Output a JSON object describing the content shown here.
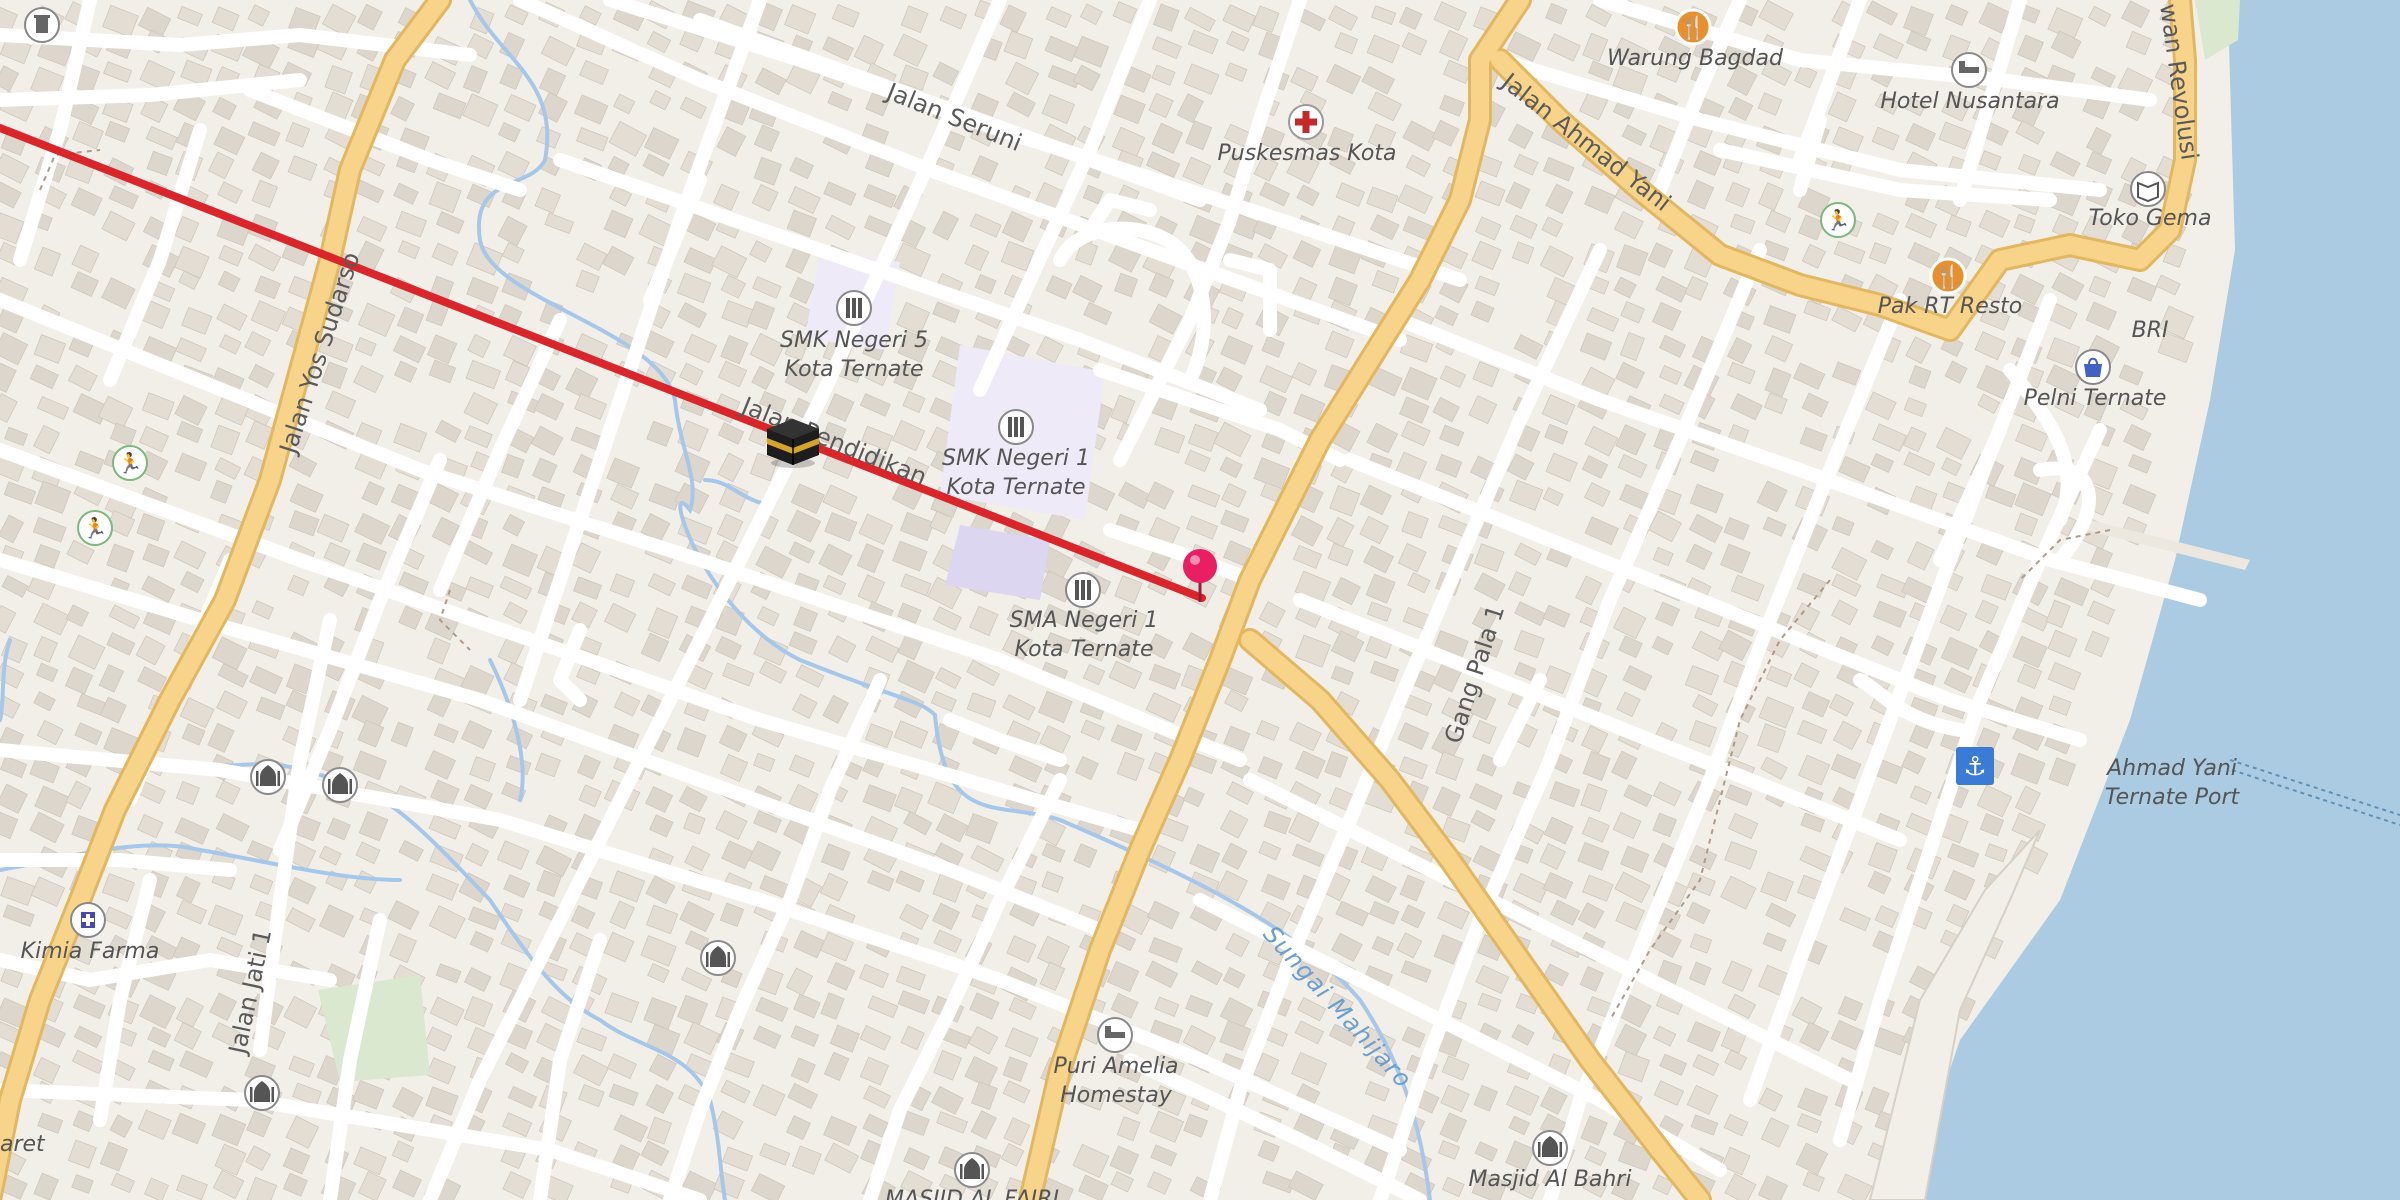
{
  "map": {
    "colors": {
      "land": "#f2efe9",
      "block": "#e9e2da",
      "building": "#ddd6cd",
      "minor_road": "#ffffff",
      "major_road": "#f7d48a",
      "major_road_casing": "#e2b75f",
      "water": "#aacbe1",
      "stream": "#a5c8ea",
      "route": "#d9262b",
      "school_area": "#eeeaf7",
      "school_block": "#dcd6f0",
      "park": "#d9e8cf",
      "pin": "#e91e63"
    },
    "roads": [
      {
        "name": "Jalan Seruni"
      },
      {
        "name": "Jalan Pendidikan"
      },
      {
        "name": "Jalan Ahmad Yani"
      },
      {
        "name": "Jalan Yos Sudarso"
      },
      {
        "name": "Gang Pala 1"
      },
      {
        "name": "Jalan Jati 1"
      },
      {
        "name": "Jalan Revolusi",
        "visible_text": "wan Revolusi"
      }
    ],
    "waterways": [
      {
        "name": "Sungai Mahijaro"
      }
    ],
    "pois": [
      {
        "name": "Warung Bagdad",
        "icon": "restaurant-icon"
      },
      {
        "name": "Hotel Nusantara",
        "icon": "hotel-icon"
      },
      {
        "name": "Puskesmas Kota",
        "icon": "clinic-icon"
      },
      {
        "name": "Toko Gema",
        "icon": "bookstore-icon"
      },
      {
        "name": "Pak RT Resto",
        "icon": "restaurant-icon"
      },
      {
        "name": "BRI",
        "icon": ""
      },
      {
        "name": "Pelni Ternate",
        "icon": "shopping-bag-icon"
      },
      {
        "name": "SMK Negeri 5",
        "name2": "Kota Ternate",
        "icon": "school-icon"
      },
      {
        "name": "SMK Negeri 1",
        "name2": "Kota Ternate",
        "icon": "school-icon"
      },
      {
        "name": "SMA Negeri 1",
        "name2": "Kota Ternate",
        "icon": "school-icon"
      },
      {
        "name": "Ahmad Yani",
        "name2": "Ternate Port",
        "icon": "anchor-icon"
      },
      {
        "name": "Kimia Farma",
        "icon": "pharmacy-icon"
      },
      {
        "name": "Puri Amelia",
        "name2": "Homestay",
        "icon": "hotel-icon"
      },
      {
        "name": "Masjid Al Bahri",
        "icon": "mosque-icon"
      },
      {
        "name": "MASJID AL FAJRI",
        "icon": "mosque-icon"
      },
      {
        "name": "aret",
        "icon": ""
      }
    ],
    "markers": {
      "route_icon": "kaaba-icon",
      "destination": "location-pin-icon"
    }
  }
}
